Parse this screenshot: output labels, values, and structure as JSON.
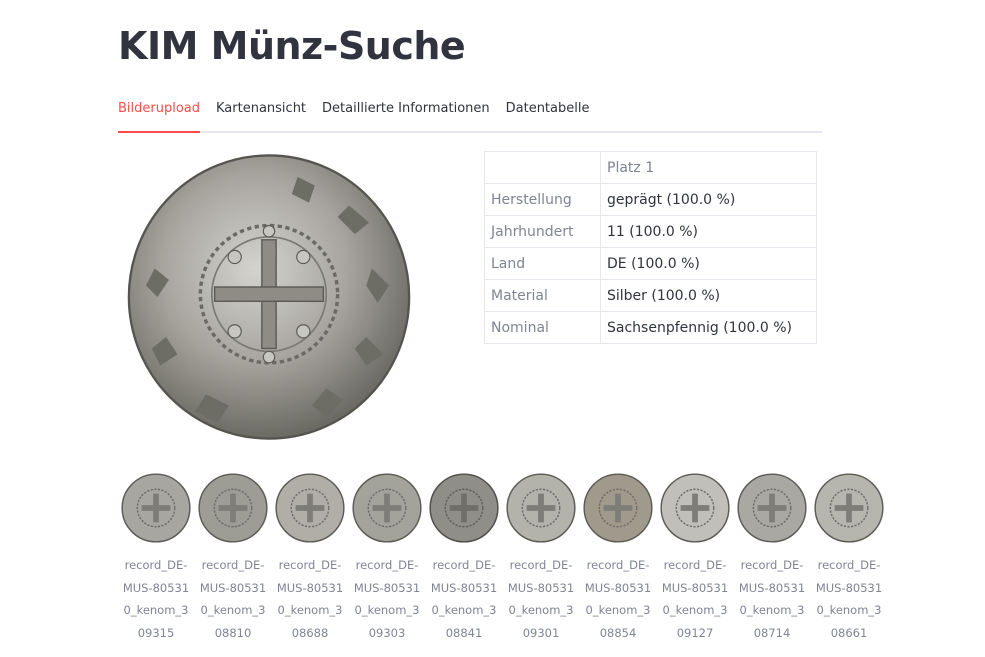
{
  "app": {
    "title": "KIM Münz-Suche"
  },
  "tabs": [
    {
      "label": "Bilderupload",
      "active": true
    },
    {
      "label": "Kartenansicht",
      "active": false
    },
    {
      "label": "Detaillierte Informationen",
      "active": false
    },
    {
      "label": "Datentabelle",
      "active": false
    }
  ],
  "main_image": {
    "icon": "coin-image"
  },
  "result_table": {
    "header": "Platz 1",
    "rows": [
      {
        "label": "Herstellung",
        "value": "geprägt (100.0 %)"
      },
      {
        "label": "Jahrhundert",
        "value": "11 (100.0 %)"
      },
      {
        "label": "Land",
        "value": "DE (100.0 %)"
      },
      {
        "label": "Material",
        "value": "Silber (100.0 %)"
      },
      {
        "label": "Nominal",
        "value": "Sachsenpfennig (100.0 %)"
      }
    ]
  },
  "thumbnails": [
    {
      "caption": "record_DE-MUS-805310_kenom_309315"
    },
    {
      "caption": "record_DE-MUS-805310_kenom_308810"
    },
    {
      "caption": "record_DE-MUS-805310_kenom_308688"
    },
    {
      "caption": "record_DE-MUS-805310_kenom_309303"
    },
    {
      "caption": "record_DE-MUS-805310_kenom_308841"
    },
    {
      "caption": "record_DE-MUS-805310_kenom_309301"
    },
    {
      "caption": "record_DE-MUS-805310_kenom_308854"
    },
    {
      "caption": "record_DE-MUS-805310_kenom_309127"
    },
    {
      "caption": "record_DE-MUS-805310_kenom_308714"
    },
    {
      "caption": "record_DE-MUS-805310_kenom_308661"
    }
  ],
  "colors": {
    "accent": "#ff4b4b",
    "text": "#31333f",
    "muted": "#808495",
    "border": "#e6e8ee",
    "coin_silver": "#a9a9a4",
    "coin_dark": "#5e5e58"
  }
}
